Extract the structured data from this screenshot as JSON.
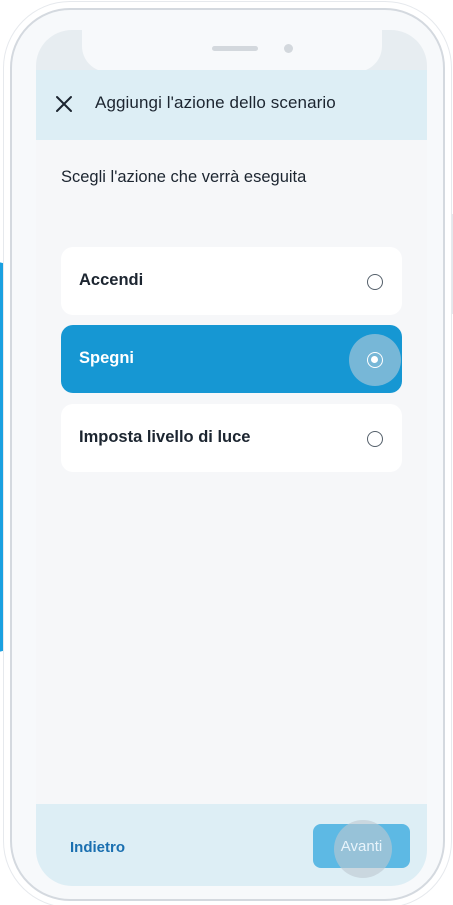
{
  "header": {
    "title": "Aggiungi l'azione dello scenario",
    "close_icon": "close-icon"
  },
  "content": {
    "prompt": "Scegli l'azione che verrà eseguita",
    "options": [
      {
        "label": "Accendi",
        "selected": false
      },
      {
        "label": "Spegni",
        "selected": true
      },
      {
        "label": "Imposta livello di luce",
        "selected": false
      }
    ]
  },
  "footer": {
    "back_label": "Indietro",
    "next_label": "Avanti"
  },
  "colors": {
    "accent": "#1697d3",
    "header_bg": "#ddeef5",
    "link": "#1a6fb0",
    "next_button": "#5db9e4"
  }
}
